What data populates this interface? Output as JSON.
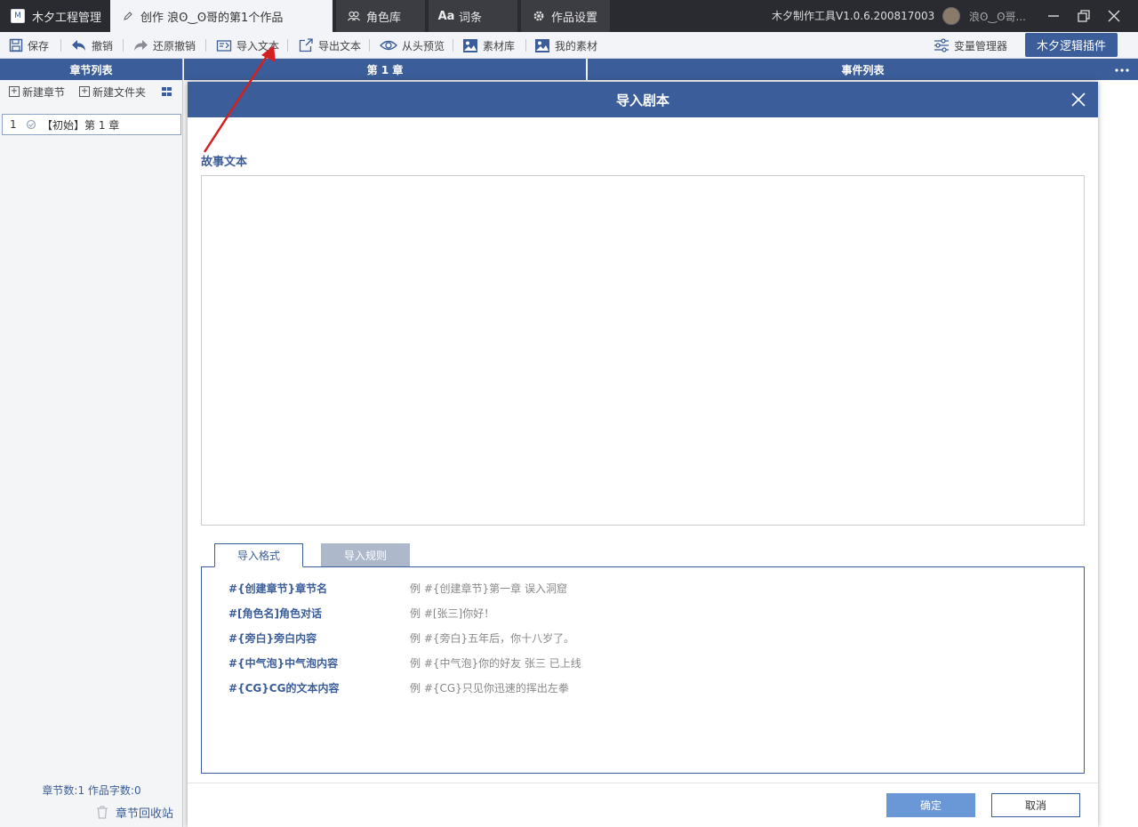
{
  "titlebar": {
    "app_tab": "木夕工程管理",
    "create_tab": "创作 浪ʘ‿ʘ哥的第1个作品",
    "role_tab": "角色库",
    "word_tab": "词条",
    "settings_tab": "作品设置",
    "version": "木夕制作工具V1.0.6.200817003",
    "username": "浪ʘ‿ʘ哥..."
  },
  "toolbar": {
    "save": "保存",
    "undo": "撤销",
    "redo": "还原撤销",
    "import_text": "导入文本",
    "export_text": "导出文本",
    "preview": "从头预览",
    "asset_lib": "素材库",
    "my_assets": "我的素材",
    "var_manager": "变量管理器",
    "plugin": "木夕逻辑插件"
  },
  "left_panel": {
    "title": "章节列表",
    "new_chapter": "新建章节",
    "new_folder": "新建文件夹",
    "chapters": [
      {
        "index": "1",
        "label": "【初始】第 1 章"
      }
    ],
    "stats": "章节数:1 作品字数:0",
    "recycle_bin": "章节回收站"
  },
  "mid_panel": {
    "title": "第 1 章"
  },
  "right_panel": {
    "title": "事件列表"
  },
  "modal": {
    "title": "导入剧本",
    "story_label": "故事文本",
    "story_value": "",
    "tab_format": "导入格式",
    "tab_rules": "导入规则",
    "formats": [
      {
        "key": "#{创建章节}章节名",
        "example": "例 #{创建章节}第一章 误入洞窟"
      },
      {
        "key": "#[角色名]角色对话",
        "example": "例 #[张三]你好！"
      },
      {
        "key": "#{旁白}旁白内容",
        "example": "例 #{旁白}五年后，你十八岁了。"
      },
      {
        "key": "#{中气泡}中气泡内容",
        "example": "例 #{中气泡}你的好友 张三 已上线"
      },
      {
        "key": "#{CG}CG的文本内容",
        "example": "例 #{CG}只见你迅速的挥出左拳"
      }
    ],
    "ok": "确定",
    "cancel": "取消"
  },
  "colors": {
    "primary": "#3b5d99",
    "titlebar": "#2a2b30",
    "ok_button": "#6a97d6",
    "annotation_arrow": "#d42020"
  }
}
